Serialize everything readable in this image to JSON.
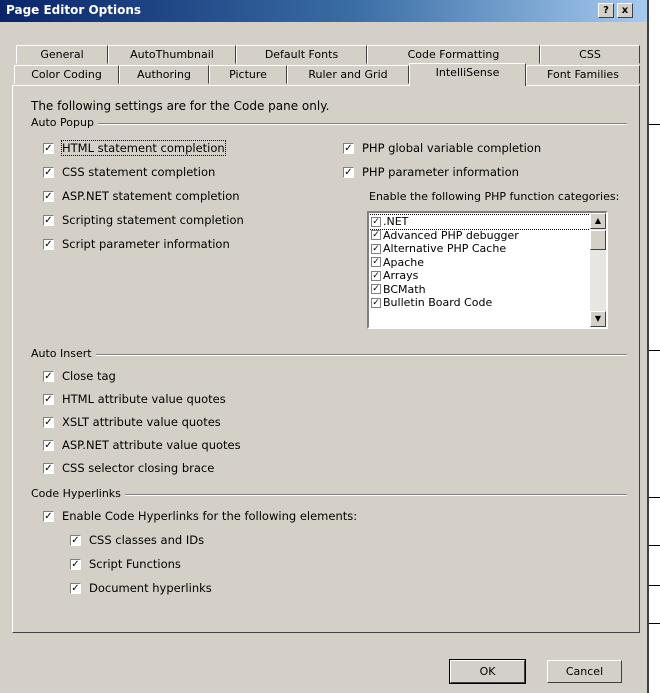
{
  "window": {
    "title": "Page Editor Options",
    "help": "?",
    "close": "x"
  },
  "tabs_back": [
    "General",
    "AutoThumbnail",
    "Default Fonts",
    "Code Formatting",
    "CSS"
  ],
  "tabs_front": [
    "Color Coding",
    "Authoring",
    "Picture",
    "Ruler and Grid",
    "IntelliSense",
    "Font Families"
  ],
  "active_tab": "IntelliSense",
  "intro": "The following settings are for the Code pane only.",
  "auto_popup": {
    "label": "Auto Popup",
    "left": [
      {
        "label": "HTML statement completion",
        "checked": true
      },
      {
        "label": "CSS statement completion",
        "checked": true
      },
      {
        "label": "ASP.NET statement completion",
        "checked": true
      },
      {
        "label": "Scripting statement completion",
        "checked": true
      },
      {
        "label": "Script parameter information",
        "checked": true
      }
    ],
    "right": [
      {
        "label": "PHP global variable completion",
        "checked": true
      },
      {
        "label": "PHP parameter information",
        "checked": true
      }
    ],
    "php_categories_label": "Enable the following PHP function categories:",
    "php_categories": [
      {
        "label": ".NET",
        "checked": true
      },
      {
        "label": "Advanced PHP debugger",
        "checked": true
      },
      {
        "label": "Alternative PHP Cache",
        "checked": true
      },
      {
        "label": "Apache",
        "checked": true
      },
      {
        "label": "Arrays",
        "checked": true
      },
      {
        "label": "BCMath",
        "checked": true
      },
      {
        "label": "Bulletin Board Code",
        "checked": true
      }
    ]
  },
  "auto_insert": {
    "label": "Auto Insert",
    "items": [
      {
        "label": "Close tag",
        "checked": true
      },
      {
        "label": "HTML attribute value quotes",
        "checked": true
      },
      {
        "label": "XSLT attribute value quotes",
        "checked": true
      },
      {
        "label": "ASP.NET attribute value quotes",
        "checked": true
      },
      {
        "label": "CSS selector closing brace",
        "checked": true
      }
    ]
  },
  "code_hyperlinks": {
    "label": "Code Hyperlinks",
    "enable": {
      "label": "Enable Code Hyperlinks for the following elements:",
      "checked": true
    },
    "items": [
      {
        "label": "CSS classes and IDs",
        "checked": true
      },
      {
        "label": "Script Functions",
        "checked": true
      },
      {
        "label": "Document hyperlinks",
        "checked": true
      }
    ]
  },
  "buttons": {
    "ok": "OK",
    "cancel": "Cancel"
  },
  "check_glyph": "✓"
}
